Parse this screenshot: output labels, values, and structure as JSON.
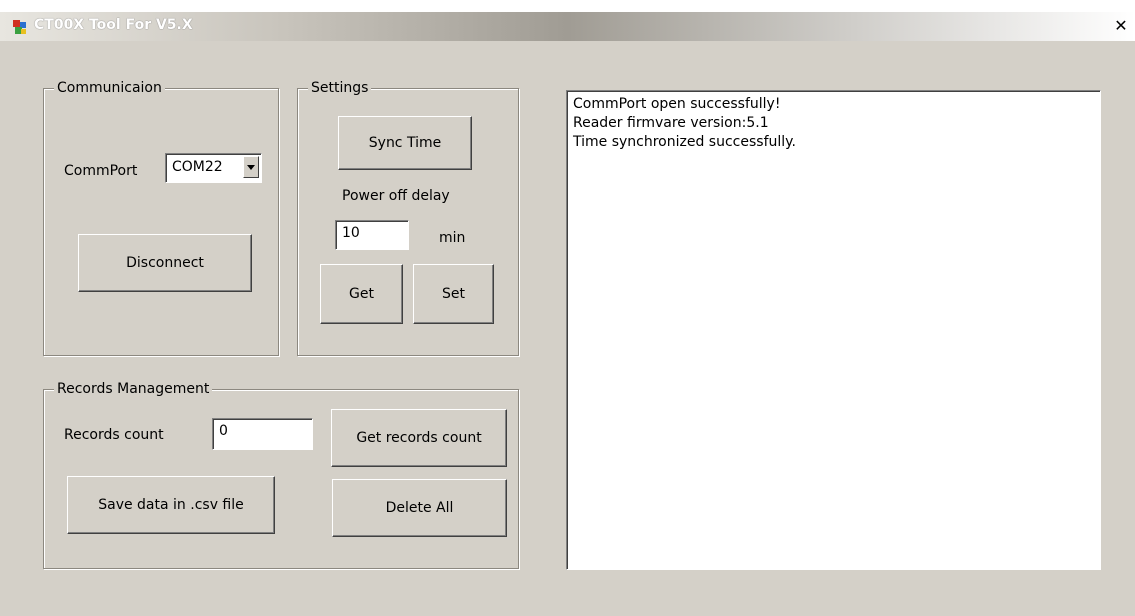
{
  "window": {
    "title": "CT00X Tool  For V5.X",
    "close_glyph": "✕"
  },
  "communication": {
    "legend": "Communicaion",
    "commport_label": "CommPort",
    "commport_value": "COM22",
    "disconnect_label": "Disconnect"
  },
  "settings": {
    "legend": "Settings",
    "sync_time_label": "Sync Time",
    "power_off_label": "Power off delay",
    "power_off_value": "10",
    "unit_label": "min",
    "get_label": "Get",
    "set_label": "Set"
  },
  "records": {
    "legend": "Records Management",
    "count_label": "Records count",
    "count_value": "0",
    "get_count_label": "Get records count",
    "save_csv_label": "Save data in .csv file",
    "delete_all_label": "Delete All"
  },
  "log": {
    "lines": [
      "CommPort open successfully!",
      "Reader firmvare version:5.1",
      "Time synchronized successfully."
    ]
  }
}
